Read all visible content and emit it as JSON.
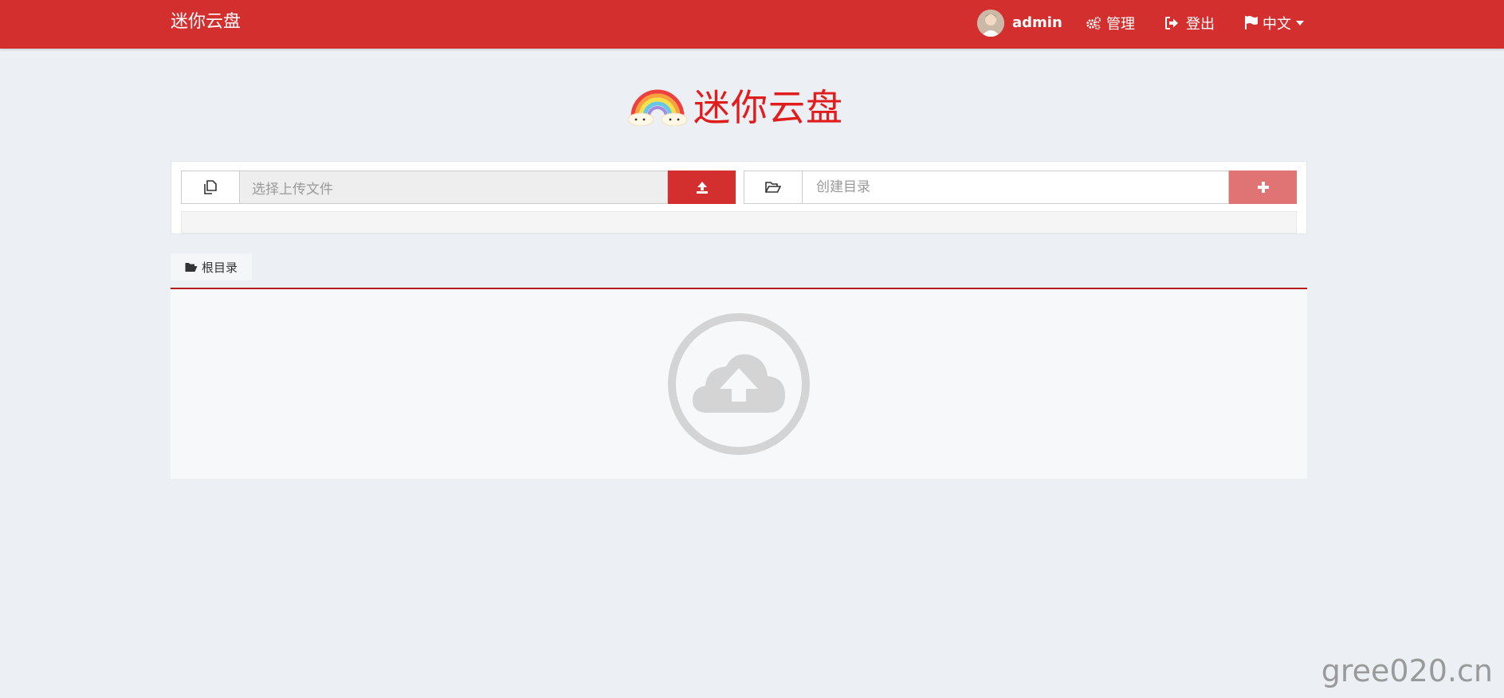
{
  "navbar": {
    "brand": "迷你云盘",
    "user": "admin",
    "manage": "管理",
    "logout": "登出",
    "language": "中文",
    "color": "#d32f2f"
  },
  "logo": {
    "text": "迷你云盘",
    "icon": "rainbow-cloud-icon"
  },
  "upload": {
    "file_placeholder": "选择上传文件",
    "mkdir_placeholder": "创建目录"
  },
  "breadcrumb": {
    "root": "根目录"
  },
  "empty_state": {
    "icon": "cloud-upload-icon"
  },
  "watermark": "gree020.cn"
}
